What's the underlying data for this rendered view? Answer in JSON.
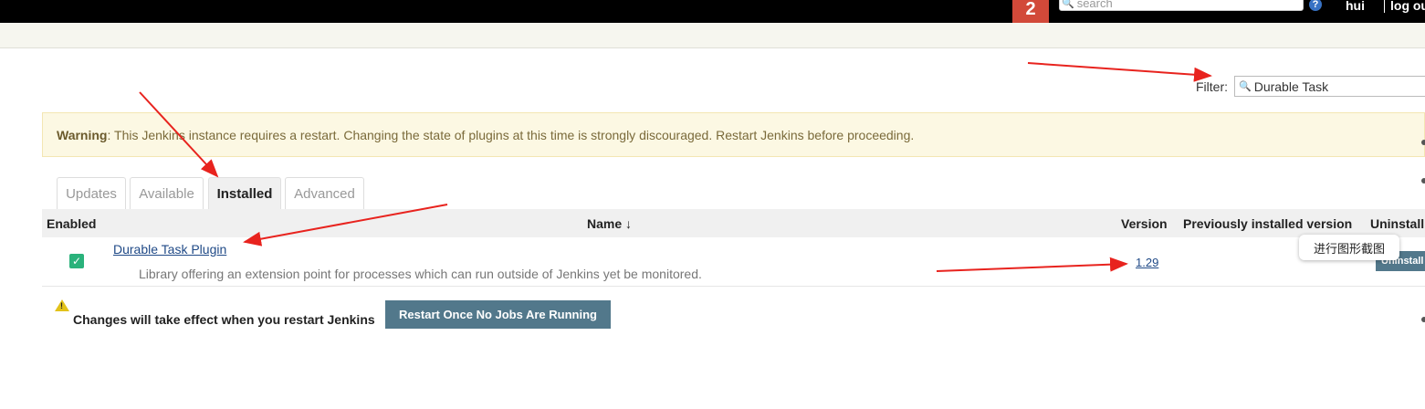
{
  "topbar": {
    "notification_count": "2",
    "search_placeholder": "search",
    "help_icon": "?",
    "user": "hui",
    "logout": "log out"
  },
  "filter": {
    "label": "Filter:",
    "value": "Durable Task"
  },
  "warning": {
    "prefix": "Warning",
    "message": ": This Jenkins instance requires a restart. Changing the state of plugins at this time is strongly discouraged. Restart Jenkins before proceeding."
  },
  "tabs": [
    {
      "label": "Updates",
      "active": false
    },
    {
      "label": "Available",
      "active": false
    },
    {
      "label": "Installed",
      "active": true
    },
    {
      "label": "Advanced",
      "active": false
    }
  ],
  "table": {
    "headers": {
      "enabled": "Enabled",
      "name": "Name ↓",
      "version": "Version",
      "previous": "Previously installed version",
      "uninstall": "Uninstall"
    },
    "rows": [
      {
        "enabled": true,
        "name": "Durable Task Plugin",
        "description": "Library offering an extension point for processes which can run outside of Jenkins yet be monitored.",
        "version": "1.29",
        "uninstall_label": "Uninstall"
      }
    ]
  },
  "tooltip": "进行图形截图",
  "notice": {
    "text": "Changes will take effect when you restart Jenkins",
    "button": "Restart Once No Jobs Are Running"
  },
  "colors": {
    "annotation_arrow": "#e8231e",
    "button": "#52788b",
    "warning_bg": "#fcf8e3"
  }
}
